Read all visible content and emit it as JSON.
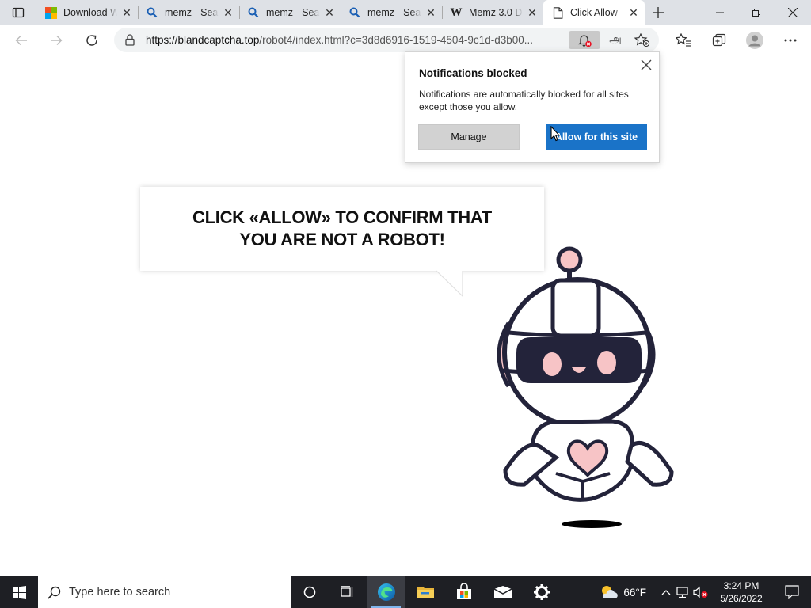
{
  "browser": {
    "tabs": [
      {
        "title": "Download W",
        "icon": "windows-logo-icon",
        "active": false
      },
      {
        "title": "memz - Sea",
        "icon": "search-icon",
        "active": false
      },
      {
        "title": "memz - Sea",
        "icon": "search-icon",
        "active": false
      },
      {
        "title": "memz - Sea",
        "icon": "search-icon",
        "active": false
      },
      {
        "title": "Memz 3.0 D",
        "icon": "wikipedia-icon",
        "active": false
      },
      {
        "title": "Click Allow",
        "icon": "page-icon",
        "active": true
      }
    ],
    "address_bar": {
      "host": "https://blandcaptcha.top",
      "path": "/robot4/index.html?c=3d8d6916-1519-4504-9c1d-d3b00..."
    },
    "read_aloud_glyph": "அ"
  },
  "notification_popup": {
    "title": "Notifications blocked",
    "body": "Notifications are automatically blocked for all sites except those you allow.",
    "manage_label": "Manage",
    "allow_label": "Allow for this site",
    "accent_color": "#1a73c8"
  },
  "page": {
    "headline": "CLICK «ALLOW» TO CONFIRM THAT YOU ARE NOT A ROBOT!",
    "robot_accent_color": "#f7c4c6",
    "robot_outline_color": "#23233a"
  },
  "taskbar": {
    "search_placeholder": "Type here to search",
    "apps": [
      "task-view-icon",
      "edge-icon",
      "file-explorer-icon",
      "store-icon",
      "mail-icon",
      "settings-icon"
    ],
    "weather": "66°F",
    "time": "3:24 PM",
    "date": "5/26/2022"
  }
}
